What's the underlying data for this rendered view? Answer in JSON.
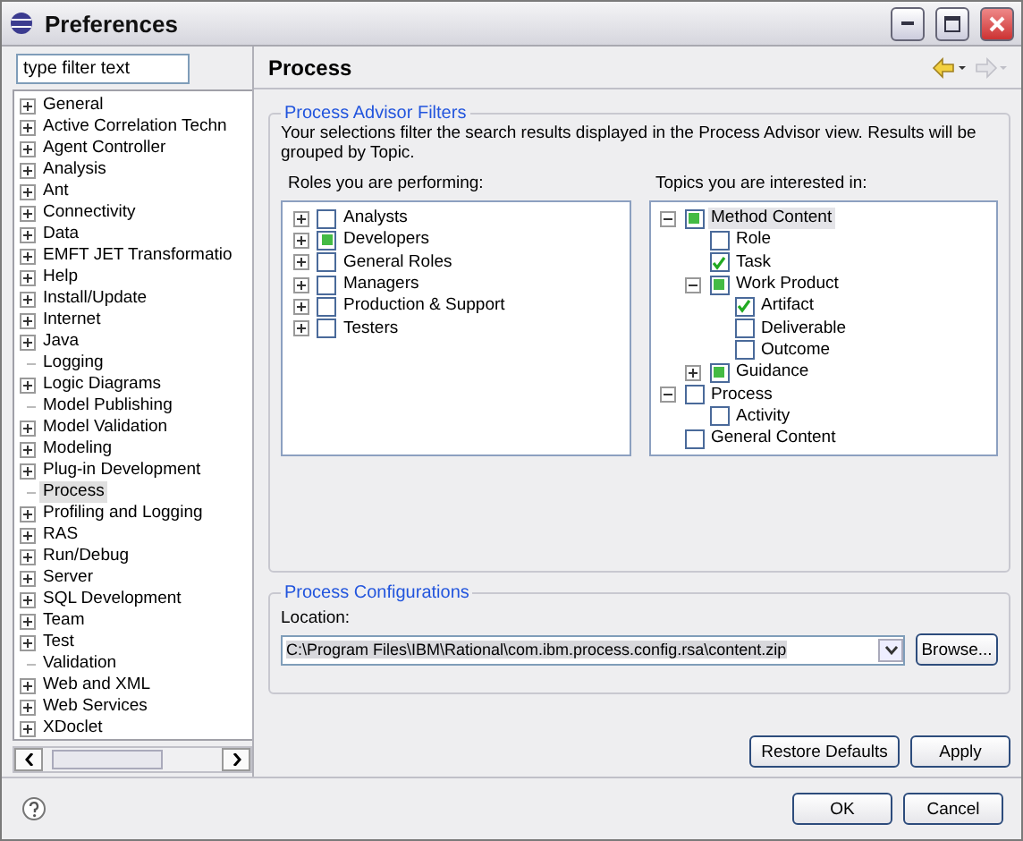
{
  "window": {
    "title": "Preferences"
  },
  "sidebar": {
    "filter": {
      "placeholder": "type filter text"
    },
    "items": [
      {
        "label": "General",
        "expandable": true,
        "selected": false
      },
      {
        "label": "Active Correlation Techn",
        "expandable": true,
        "selected": false
      },
      {
        "label": "Agent Controller",
        "expandable": true,
        "selected": false
      },
      {
        "label": "Analysis",
        "expandable": true,
        "selected": false
      },
      {
        "label": "Ant",
        "expandable": true,
        "selected": false
      },
      {
        "label": "Connectivity",
        "expandable": true,
        "selected": false
      },
      {
        "label": "Data",
        "expandable": true,
        "selected": false
      },
      {
        "label": "EMFT JET Transformatio",
        "expandable": true,
        "selected": false
      },
      {
        "label": "Help",
        "expandable": true,
        "selected": false
      },
      {
        "label": "Install/Update",
        "expandable": true,
        "selected": false
      },
      {
        "label": "Internet",
        "expandable": true,
        "selected": false
      },
      {
        "label": "Java",
        "expandable": true,
        "selected": false
      },
      {
        "label": "Logging",
        "expandable": false,
        "selected": false
      },
      {
        "label": "Logic Diagrams",
        "expandable": true,
        "selected": false
      },
      {
        "label": "Model Publishing",
        "expandable": false,
        "selected": false
      },
      {
        "label": "Model Validation",
        "expandable": true,
        "selected": false
      },
      {
        "label": "Modeling",
        "expandable": true,
        "selected": false
      },
      {
        "label": "Plug-in Development",
        "expandable": true,
        "selected": false
      },
      {
        "label": "Process",
        "expandable": false,
        "selected": true
      },
      {
        "label": "Profiling and Logging",
        "expandable": true,
        "selected": false
      },
      {
        "label": "RAS",
        "expandable": true,
        "selected": false
      },
      {
        "label": "Run/Debug",
        "expandable": true,
        "selected": false
      },
      {
        "label": "Server",
        "expandable": true,
        "selected": false
      },
      {
        "label": "SQL Development",
        "expandable": true,
        "selected": false
      },
      {
        "label": "Team",
        "expandable": true,
        "selected": false
      },
      {
        "label": "Test",
        "expandable": true,
        "selected": false
      },
      {
        "label": "Validation",
        "expandable": false,
        "selected": false
      },
      {
        "label": "Web and XML",
        "expandable": true,
        "selected": false
      },
      {
        "label": "Web Services",
        "expandable": true,
        "selected": false
      },
      {
        "label": "XDoclet",
        "expandable": true,
        "selected": false
      }
    ]
  },
  "page": {
    "title": "Process",
    "filters": {
      "legend": "Process Advisor Filters",
      "description": "Your selections filter the search results displayed in the Process Advisor view. Results will be grouped by Topic.",
      "roles": {
        "label": "Roles you are performing:",
        "items": [
          {
            "label": "Analysts",
            "expandable": true,
            "expanded": false,
            "checked": false,
            "partial": false,
            "selected": false
          },
          {
            "label": "Developers",
            "expandable": true,
            "expanded": false,
            "checked": false,
            "partial": true,
            "selected": false
          },
          {
            "label": "General Roles",
            "expandable": true,
            "expanded": false,
            "checked": false,
            "partial": false,
            "selected": false
          },
          {
            "label": "Managers",
            "expandable": true,
            "expanded": false,
            "checked": false,
            "partial": false,
            "selected": false
          },
          {
            "label": "Production & Support",
            "expandable": true,
            "expanded": false,
            "checked": false,
            "partial": false,
            "selected": false
          },
          {
            "label": "Testers",
            "expandable": true,
            "expanded": false,
            "checked": false,
            "partial": false,
            "selected": false
          }
        ]
      },
      "topics": {
        "label": "Topics you are interested in:",
        "items": [
          {
            "label": "Method Content",
            "expandable": true,
            "expanded": true,
            "checked": false,
            "partial": true,
            "selected": true,
            "children": [
              {
                "label": "Role",
                "expandable": false,
                "checked": false,
                "partial": false,
                "selected": false
              },
              {
                "label": "Task",
                "expandable": false,
                "checked": true,
                "partial": false,
                "selected": false
              },
              {
                "label": "Work Product",
                "expandable": true,
                "expanded": true,
                "checked": false,
                "partial": true,
                "selected": false,
                "children": [
                  {
                    "label": "Artifact",
                    "expandable": false,
                    "checked": true,
                    "partial": false,
                    "selected": false
                  },
                  {
                    "label": "Deliverable",
                    "expandable": false,
                    "checked": false,
                    "partial": false,
                    "selected": false
                  },
                  {
                    "label": "Outcome",
                    "expandable": false,
                    "checked": false,
                    "partial": false,
                    "selected": false
                  }
                ]
              },
              {
                "label": "Guidance",
                "expandable": true,
                "expanded": false,
                "checked": false,
                "partial": true,
                "selected": false
              }
            ]
          },
          {
            "label": "Process",
            "expandable": true,
            "expanded": true,
            "checked": false,
            "partial": false,
            "selected": false,
            "children": [
              {
                "label": "Activity",
                "expandable": false,
                "checked": false,
                "partial": false,
                "selected": false
              }
            ]
          },
          {
            "label": "General Content",
            "expandable": false,
            "checked": false,
            "partial": false,
            "selected": false
          }
        ]
      }
    },
    "configurations": {
      "legend": "Process Configurations",
      "location_label": "Location:",
      "location": "C:\\Program Files\\IBM\\Rational\\com.ibm.process.config.rsa\\content.zip",
      "browse": "Browse..."
    },
    "buttons": [
      "Restore Defaults",
      "Apply"
    ]
  },
  "footer": {
    "buttons": [
      "OK",
      "Cancel"
    ]
  }
}
